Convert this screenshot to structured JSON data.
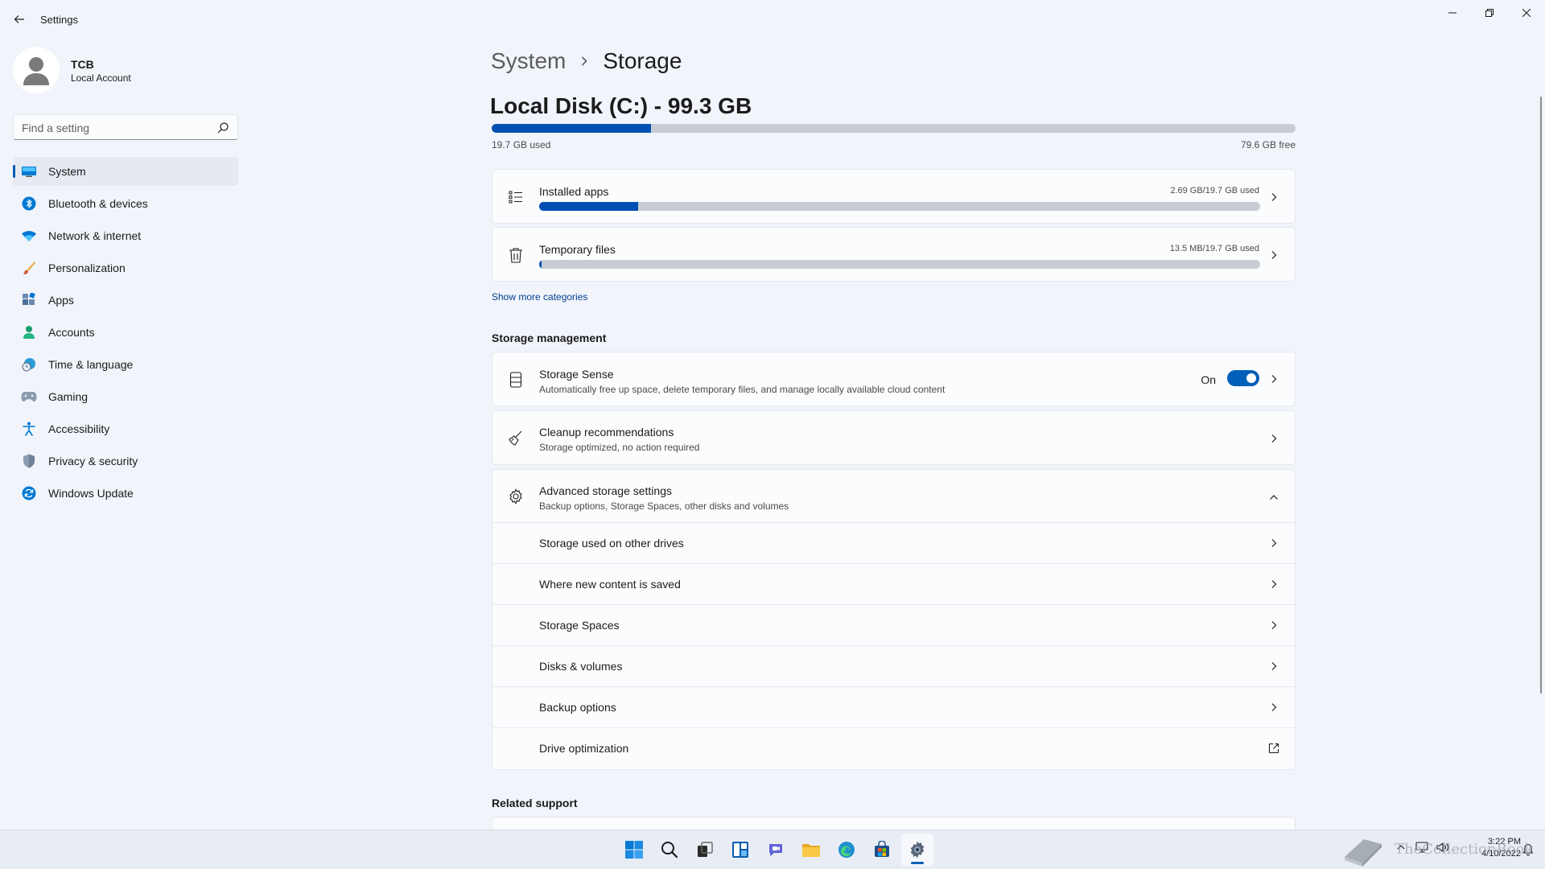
{
  "window": {
    "app_title": "Settings"
  },
  "profile": {
    "name": "TCB",
    "account_type": "Local Account"
  },
  "search": {
    "placeholder": "Find a setting"
  },
  "sidebar": {
    "items": [
      {
        "label": "System",
        "icon": "monitor-icon",
        "active": true
      },
      {
        "label": "Bluetooth & devices",
        "icon": "bluetooth-icon"
      },
      {
        "label": "Network & internet",
        "icon": "wifi-icon"
      },
      {
        "label": "Personalization",
        "icon": "brush-icon"
      },
      {
        "label": "Apps",
        "icon": "apps-icon"
      },
      {
        "label": "Accounts",
        "icon": "person-icon"
      },
      {
        "label": "Time & language",
        "icon": "clock-globe-icon"
      },
      {
        "label": "Gaming",
        "icon": "gamepad-icon"
      },
      {
        "label": "Accessibility",
        "icon": "accessibility-icon"
      },
      {
        "label": "Privacy & security",
        "icon": "shield-icon"
      },
      {
        "label": "Windows Update",
        "icon": "update-icon"
      }
    ]
  },
  "breadcrumb": {
    "parent": "System",
    "current": "Storage"
  },
  "disk": {
    "title": "Local Disk (C:) - 99.3 GB",
    "used_label": "19.7 GB used",
    "free_label": "79.6 GB free",
    "used_fraction": 0.198
  },
  "categories": [
    {
      "title": "Installed apps",
      "usage": "2.69 GB/19.7 GB used",
      "fraction": 0.137,
      "icon": "list-icon"
    },
    {
      "title": "Temporary files",
      "usage": "13.5 MB/19.7 GB used",
      "fraction": 0.001,
      "icon": "trash-icon"
    }
  ],
  "show_more": "Show more categories",
  "storage_management": {
    "heading": "Storage management",
    "storage_sense": {
      "title": "Storage Sense",
      "desc": "Automatically free up space, delete temporary files, and manage locally available cloud content",
      "toggle_label": "On",
      "enabled": true
    },
    "cleanup": {
      "title": "Cleanup recommendations",
      "desc": "Storage optimized, no action required"
    },
    "advanced": {
      "title": "Advanced storage settings",
      "desc": "Backup options, Storage Spaces, other disks and volumes",
      "items": [
        {
          "label": "Storage used on other drives",
          "icon": "chevron-right-icon"
        },
        {
          "label": "Where new content is saved",
          "icon": "chevron-right-icon"
        },
        {
          "label": "Storage Spaces",
          "icon": "chevron-right-icon"
        },
        {
          "label": "Disks & volumes",
          "icon": "chevron-right-icon"
        },
        {
          "label": "Backup options",
          "icon": "chevron-right-icon"
        },
        {
          "label": "Drive optimization",
          "icon": "external-link-icon"
        }
      ]
    }
  },
  "related_support": {
    "heading": "Related support"
  },
  "taskbar": {
    "time": "3:22 PM",
    "date": "4/10/2022",
    "watermark": "TheCollectionBook"
  },
  "colors": {
    "accent": "#005fb8",
    "bar_fill": "#0050b3",
    "bar_track": "#c7ccd3"
  }
}
